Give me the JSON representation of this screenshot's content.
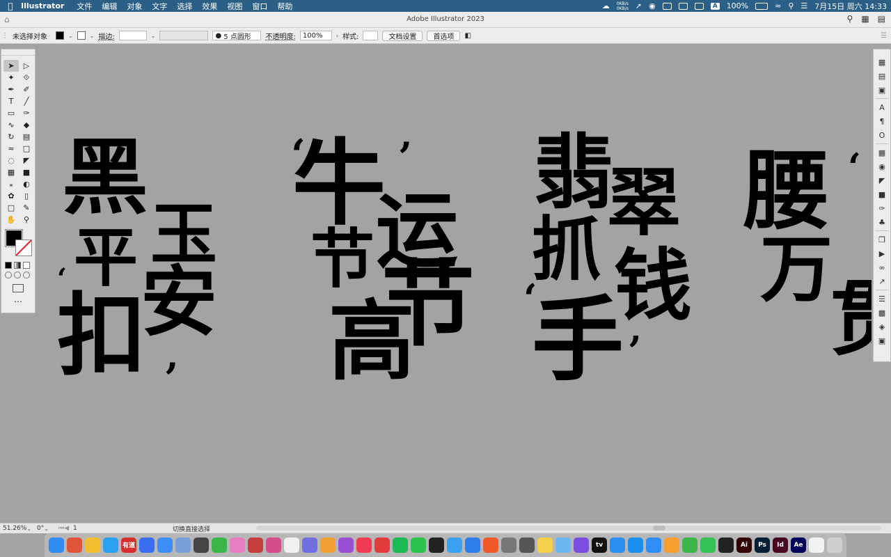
{
  "menubar": {
    "app_name": "Illustrator",
    "items": [
      "文件",
      "编辑",
      "对象",
      "文字",
      "选择",
      "效果",
      "视图",
      "窗口",
      "帮助"
    ],
    "net_up": "0KB/s",
    "net_down": "0KB/s",
    "input_method": "A",
    "battery": "100%",
    "datetime": "7月15日 周六  14:33"
  },
  "titlebar": {
    "title": "Adobe Illustrator 2023"
  },
  "control_bar": {
    "selection_label": "未选择对象",
    "fill_color": "#000000",
    "stroke_label": "描边:",
    "brush_label": "5 点圆形",
    "opacity_label": "不透明度:",
    "opacity_value": "100%",
    "style_label": "样式:",
    "doc_setup_button": "文档设置",
    "preferences_button": "首选项"
  },
  "artwork": {
    "group1": [
      "黑",
      "玉",
      "平",
      "安",
      "扣"
    ],
    "group2": [
      "牛",
      "运",
      "节",
      "节",
      "高"
    ],
    "group3": [
      "翡",
      "翠",
      "抓",
      "钱",
      "手"
    ],
    "group4": [
      "腰",
      "万",
      "贯"
    ]
  },
  "status_bar": {
    "zoom": "51.26%",
    "rotation": "0°",
    "artboard": "1",
    "tool_hint": "切换直接选择"
  },
  "dock": {
    "apps": [
      {
        "name": "Finder",
        "color": "#2f8cf0"
      },
      {
        "name": "Launchpad",
        "color": "#e0553a"
      },
      {
        "name": "Chrome",
        "color": "#f2c02f"
      },
      {
        "name": "Safari",
        "color": "#2aa0f0"
      },
      {
        "name": "有道",
        "label": "有道",
        "color": "#d72e2e"
      },
      {
        "name": "App",
        "color": "#3b6ff0"
      },
      {
        "name": "Mail",
        "color": "#3e8ef7"
      },
      {
        "name": "App2",
        "color": "#7aa0d9"
      },
      {
        "name": "Vectorworks",
        "color": "#444"
      },
      {
        "name": "Numbers",
        "color": "#3cb549"
      },
      {
        "name": "Photos",
        "color": "#e87ec0"
      },
      {
        "name": "PDF",
        "color": "#c73c3c"
      },
      {
        "name": "App3",
        "color": "#d44c8a"
      },
      {
        "name": "Docs",
        "color": "#f0f0f0"
      },
      {
        "name": "Downloads",
        "color": "#6f6fe0"
      },
      {
        "name": "App4",
        "color": "#f0a030"
      },
      {
        "name": "Podcasts",
        "color": "#9b4fd6"
      },
      {
        "name": "Music",
        "color": "#f23c54"
      },
      {
        "name": "NetEase",
        "color": "#e23c3c"
      },
      {
        "name": "Spotify",
        "color": "#1db954"
      },
      {
        "name": "WeChat",
        "color": "#2dc24a"
      },
      {
        "name": "QQ",
        "color": "#222"
      },
      {
        "name": "App5",
        "color": "#3aa0f0"
      },
      {
        "name": "App6",
        "color": "#2d7ee8"
      },
      {
        "name": "App7",
        "color": "#f05a2a"
      },
      {
        "name": "Preferences",
        "color": "#777"
      },
      {
        "name": "Calculator",
        "color": "#555"
      },
      {
        "name": "Notes",
        "color": "#f5d14a"
      },
      {
        "name": "App8",
        "color": "#6bb7f0"
      },
      {
        "name": "iMovie",
        "color": "#7a4fe0"
      },
      {
        "name": "Apple TV",
        "label": "tv",
        "color": "#111"
      },
      {
        "name": "App9",
        "color": "#2a8ef0"
      },
      {
        "name": "App Store",
        "color": "#1a8ff0"
      },
      {
        "name": "Keynote",
        "color": "#2e8ef5"
      },
      {
        "name": "Pages",
        "color": "#f5a030"
      },
      {
        "name": "Numbers2",
        "color": "#3cb549"
      },
      {
        "name": "FaceTime",
        "color": "#35c454"
      },
      {
        "name": "Final Cut",
        "color": "#222"
      },
      {
        "name": "Illustrator",
        "label": "Ai",
        "color": "#330000"
      },
      {
        "name": "Photoshop",
        "label": "Ps",
        "color": "#001e36"
      },
      {
        "name": "InDesign",
        "label": "Id",
        "color": "#49021f"
      },
      {
        "name": "After Effects",
        "label": "Ae",
        "color": "#00005b"
      },
      {
        "name": "Document",
        "color": "#f2f2f2"
      },
      {
        "name": "Trash",
        "color": "#cfcfcf"
      }
    ]
  }
}
